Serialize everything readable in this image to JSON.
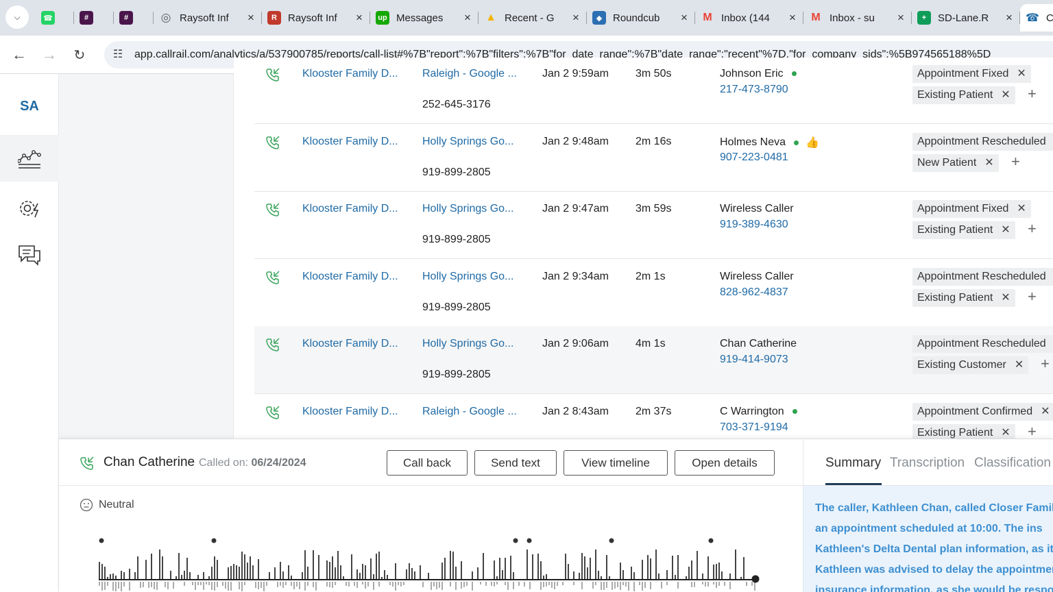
{
  "browser": {
    "tabs": [
      {
        "label": "",
        "icon": "whatsapp-icon",
        "color": "#25D366"
      },
      {
        "label": "",
        "icon": "slack-icon",
        "color": "#4A154B"
      },
      {
        "label": "",
        "icon": "slack-icon",
        "color": "#4A154B"
      },
      {
        "label": "Raysoft Inf",
        "icon": "globe-icon",
        "color": "#5f6368"
      },
      {
        "label": "Raysoft Inf",
        "icon": "raysoft-icon",
        "color": "#c0392b"
      },
      {
        "label": "Messages",
        "icon": "upwork-icon",
        "color": "#14a800"
      },
      {
        "label": "Recent - G",
        "icon": "drive-icon",
        "color": "#f4b400"
      },
      {
        "label": "Roundcub",
        "icon": "roundcube-icon",
        "color": "#2c6fb2"
      },
      {
        "label": "Inbox (144",
        "icon": "gmail-icon",
        "color": "#ea4335"
      },
      {
        "label": "Inbox - su",
        "icon": "gmail-icon",
        "color": "#ea4335"
      },
      {
        "label": "SD-Lane.R",
        "icon": "sheets-icon",
        "color": "#0f9d58"
      },
      {
        "label": "C",
        "icon": "callrail-icon",
        "color": "#1f6aa5"
      }
    ],
    "url": "app.callrail.com/analytics/a/537900785/reports/call-list#%7B\"report\":%7B\"filters\":%7B\"for_date_range\":%7B\"date_range\":\"recent\"%7D,\"for_company_sids\":%5B974565188%5D"
  },
  "rail": {
    "logo": "SA",
    "items": [
      "analytics-icon",
      "settings-icon",
      "conversations-icon"
    ]
  },
  "calls": [
    {
      "company": "Klooster Family D...",
      "source": "Raleigh - Google ...",
      "tracking": "252-645-3176",
      "date": "Jan 2 9:59am",
      "duration": "3m 50s",
      "caller": "Johnson Eric",
      "caller_phone": "217-473-8790",
      "status_dot": true,
      "thumbs": false,
      "tags": [
        "Appointment Fixed",
        "Existing Patient"
      ],
      "highlighted": false
    },
    {
      "company": "Klooster Family D...",
      "source": "Holly Springs Go...",
      "tracking": "919-899-2805",
      "date": "Jan 2 9:48am",
      "duration": "2m 16s",
      "caller": "Holmes Neva",
      "caller_phone": "907-223-0481",
      "status_dot": true,
      "thumbs": true,
      "tags": [
        "Appointment Rescheduled",
        "New Patient"
      ],
      "highlighted": false
    },
    {
      "company": "Klooster Family D...",
      "source": "Holly Springs Go...",
      "tracking": "919-899-2805",
      "date": "Jan 2 9:47am",
      "duration": "3m 59s",
      "caller": "Wireless Caller",
      "caller_phone": "919-389-4630",
      "status_dot": false,
      "thumbs": false,
      "tags": [
        "Appointment Fixed",
        "Existing Patient"
      ],
      "highlighted": false
    },
    {
      "company": "Klooster Family D...",
      "source": "Holly Springs Go...",
      "tracking": "919-899-2805",
      "date": "Jan 2 9:34am",
      "duration": "2m 1s",
      "caller": "Wireless Caller",
      "caller_phone": "828-962-4837",
      "status_dot": false,
      "thumbs": false,
      "tags": [
        "Appointment Rescheduled",
        "Existing Patient"
      ],
      "highlighted": false
    },
    {
      "company": "Klooster Family D...",
      "source": "Holly Springs Go...",
      "tracking": "919-899-2805",
      "date": "Jan 2 9:06am",
      "duration": "4m 1s",
      "caller": "Chan Catherine",
      "caller_phone": "919-414-9073",
      "status_dot": false,
      "thumbs": false,
      "tags": [
        "Appointment Rescheduled",
        "Existing Customer"
      ],
      "highlighted": true
    },
    {
      "company": "Klooster Family D...",
      "source": "Raleigh - Google ...",
      "tracking": "",
      "date": "Jan 2 8:43am",
      "duration": "2m 37s",
      "caller": "C Warrington",
      "caller_phone": "703-371-9194",
      "status_dot": true,
      "thumbs": false,
      "tags": [
        "Appointment Confirmed",
        "Existing Patient"
      ],
      "highlighted": false
    }
  ],
  "panel": {
    "caller": "Chan Catherine",
    "called_on_label": "Called on:",
    "called_on": "06/24/2024",
    "buttons": {
      "call_back": "Call back",
      "send_text": "Send text",
      "view_timeline": "View timeline",
      "open_details": "Open details"
    },
    "sentiment": "Neutral",
    "tabs": {
      "summary": "Summary",
      "transcription": "Transcription",
      "classification": "Classification"
    },
    "summary_text": "The caller, Kathleen Chan, called Closer Family for an appointment scheduled at 10:00. The ins Kathleen's Delta Dental plan information, as it Kathleen was advised to delay the appointmer insurance information, as she would be respo"
  },
  "colors": {
    "link": "#1f6aa5",
    "green": "#2ea44f",
    "summary_bg": "#eaf3fb",
    "summary_text": "#3d8fd1"
  }
}
